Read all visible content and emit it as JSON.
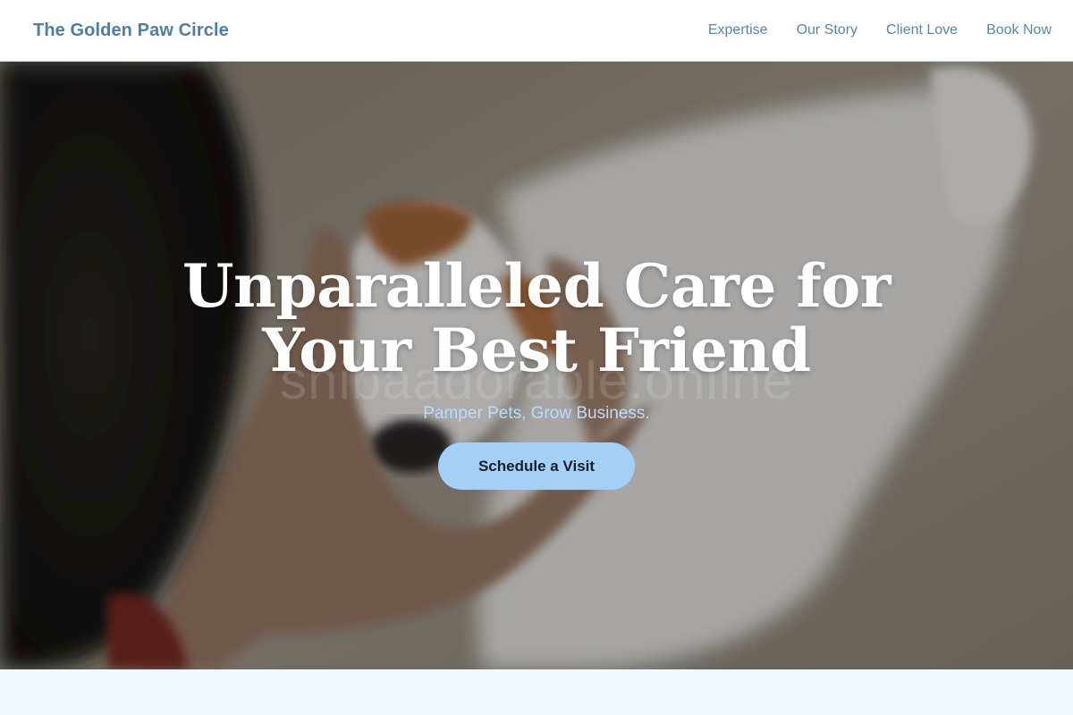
{
  "nav": {
    "brand": "The Golden Paw Circle",
    "links": [
      "Expertise",
      "Our Story",
      "Client Love",
      "Book Now"
    ]
  },
  "hero": {
    "title": "Unparalleled Care for Your Best Friend",
    "subtitle": "Pamper Pets, Grow Business.",
    "cta_label": "Schedule a Visit",
    "watermark": "shibaadorable.online"
  },
  "colors": {
    "brand": "#4e7f9f",
    "nav_link": "#5a87a6",
    "cta_bg": "#a4cff7",
    "subtitle": "#bcdcff",
    "section_bg": "#f3f8fe"
  }
}
